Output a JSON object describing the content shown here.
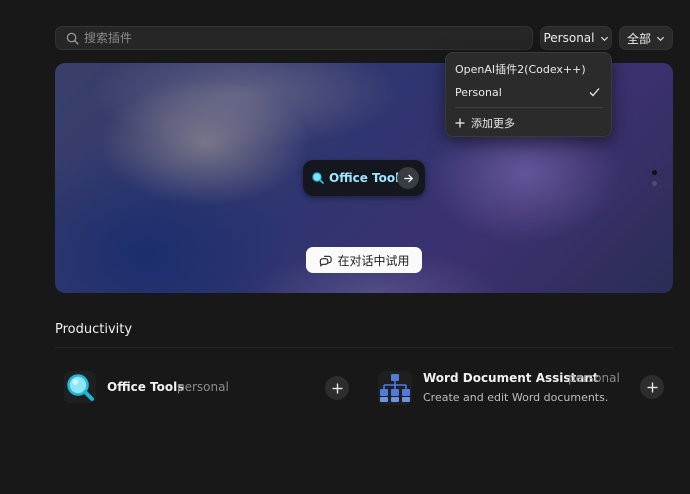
{
  "search": {
    "placeholder": "搜索插件"
  },
  "filters": {
    "account": "Personal",
    "scope": "全部"
  },
  "dropdown": {
    "items": [
      {
        "label": "OpenAI插件2(Codex++)",
        "selected": false
      },
      {
        "label": "Personal",
        "selected": true
      }
    ],
    "add_more": "添加更多"
  },
  "hero": {
    "feature_label": "Office Tools",
    "try_label": "在对话中试用",
    "carousel": {
      "count": 2,
      "active_index": 1
    }
  },
  "section": {
    "title": "Productivity",
    "plugins": [
      {
        "name": "Office Tools",
        "tag": "personal",
        "description": "",
        "icon": "magnifier-icon"
      },
      {
        "name": "Word Document Assistant",
        "tag": "personal",
        "description": "Create and edit Word documents.",
        "icon": "org-chart-icon"
      }
    ]
  },
  "colors": {
    "background": "#181818",
    "accent_cyan": "#29c9e8",
    "org_blue": "#4f7bdc"
  }
}
